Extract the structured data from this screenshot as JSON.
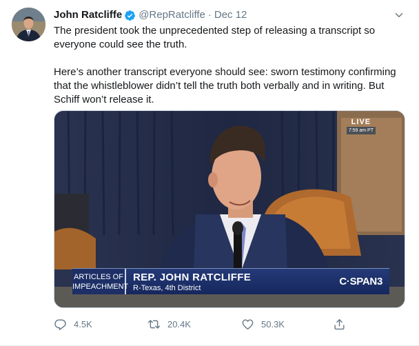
{
  "tweet": {
    "author_name": "John Ratcliffe",
    "handle": "@RepRatcliffe",
    "separator": "·",
    "date": "Dec 12",
    "paragraphs": [
      "The president took the unprecedented step of releasing a transcript so everyone could see the truth.",
      "Here’s another transcript everyone should see: sworn testimony confirming that the whistleblower didn’t tell the truth both verbally and in writing. But Schiff won’t release it."
    ]
  },
  "media": {
    "live_label": "LIVE",
    "live_time": "7:59 am PT",
    "section_line1": "ARTICLES OF",
    "section_line2": "IMPEACHMENT",
    "speaker_name": "REP. JOHN RATCLIFFE",
    "speaker_detail": "R-Texas, 4th District",
    "network": "C·SPAN3"
  },
  "actions": {
    "replies": "4.5K",
    "retweets": "20.4K",
    "likes": "50.3K"
  },
  "colors": {
    "verified": "#1da1f2",
    "muted": "#657786",
    "text": "#14171a"
  },
  "icons": [
    "verified-badge-icon",
    "chevron-down-icon",
    "reply-icon",
    "retweet-icon",
    "like-icon",
    "share-icon"
  ]
}
